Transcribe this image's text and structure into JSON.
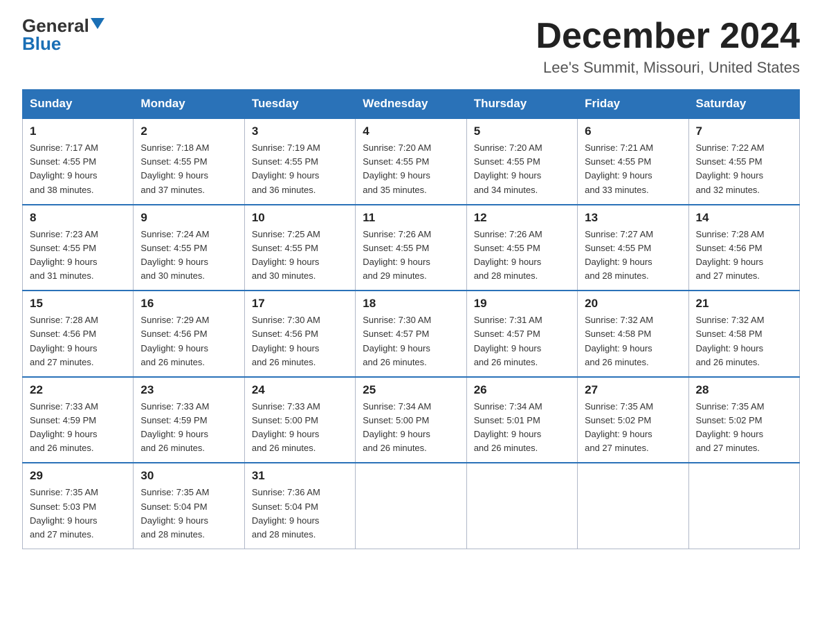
{
  "logo": {
    "general": "General",
    "blue": "Blue"
  },
  "title": "December 2024",
  "location": "Lee's Summit, Missouri, United States",
  "days_of_week": [
    "Sunday",
    "Monday",
    "Tuesday",
    "Wednesday",
    "Thursday",
    "Friday",
    "Saturday"
  ],
  "weeks": [
    [
      {
        "day": "1",
        "sunrise": "7:17 AM",
        "sunset": "4:55 PM",
        "daylight": "9 hours and 38 minutes."
      },
      {
        "day": "2",
        "sunrise": "7:18 AM",
        "sunset": "4:55 PM",
        "daylight": "9 hours and 37 minutes."
      },
      {
        "day": "3",
        "sunrise": "7:19 AM",
        "sunset": "4:55 PM",
        "daylight": "9 hours and 36 minutes."
      },
      {
        "day": "4",
        "sunrise": "7:20 AM",
        "sunset": "4:55 PM",
        "daylight": "9 hours and 35 minutes."
      },
      {
        "day": "5",
        "sunrise": "7:20 AM",
        "sunset": "4:55 PM",
        "daylight": "9 hours and 34 minutes."
      },
      {
        "day": "6",
        "sunrise": "7:21 AM",
        "sunset": "4:55 PM",
        "daylight": "9 hours and 33 minutes."
      },
      {
        "day": "7",
        "sunrise": "7:22 AM",
        "sunset": "4:55 PM",
        "daylight": "9 hours and 32 minutes."
      }
    ],
    [
      {
        "day": "8",
        "sunrise": "7:23 AM",
        "sunset": "4:55 PM",
        "daylight": "9 hours and 31 minutes."
      },
      {
        "day": "9",
        "sunrise": "7:24 AM",
        "sunset": "4:55 PM",
        "daylight": "9 hours and 30 minutes."
      },
      {
        "day": "10",
        "sunrise": "7:25 AM",
        "sunset": "4:55 PM",
        "daylight": "9 hours and 30 minutes."
      },
      {
        "day": "11",
        "sunrise": "7:26 AM",
        "sunset": "4:55 PM",
        "daylight": "9 hours and 29 minutes."
      },
      {
        "day": "12",
        "sunrise": "7:26 AM",
        "sunset": "4:55 PM",
        "daylight": "9 hours and 28 minutes."
      },
      {
        "day": "13",
        "sunrise": "7:27 AM",
        "sunset": "4:55 PM",
        "daylight": "9 hours and 28 minutes."
      },
      {
        "day": "14",
        "sunrise": "7:28 AM",
        "sunset": "4:56 PM",
        "daylight": "9 hours and 27 minutes."
      }
    ],
    [
      {
        "day": "15",
        "sunrise": "7:28 AM",
        "sunset": "4:56 PM",
        "daylight": "9 hours and 27 minutes."
      },
      {
        "day": "16",
        "sunrise": "7:29 AM",
        "sunset": "4:56 PM",
        "daylight": "9 hours and 26 minutes."
      },
      {
        "day": "17",
        "sunrise": "7:30 AM",
        "sunset": "4:56 PM",
        "daylight": "9 hours and 26 minutes."
      },
      {
        "day": "18",
        "sunrise": "7:30 AM",
        "sunset": "4:57 PM",
        "daylight": "9 hours and 26 minutes."
      },
      {
        "day": "19",
        "sunrise": "7:31 AM",
        "sunset": "4:57 PM",
        "daylight": "9 hours and 26 minutes."
      },
      {
        "day": "20",
        "sunrise": "7:32 AM",
        "sunset": "4:58 PM",
        "daylight": "9 hours and 26 minutes."
      },
      {
        "day": "21",
        "sunrise": "7:32 AM",
        "sunset": "4:58 PM",
        "daylight": "9 hours and 26 minutes."
      }
    ],
    [
      {
        "day": "22",
        "sunrise": "7:33 AM",
        "sunset": "4:59 PM",
        "daylight": "9 hours and 26 minutes."
      },
      {
        "day": "23",
        "sunrise": "7:33 AM",
        "sunset": "4:59 PM",
        "daylight": "9 hours and 26 minutes."
      },
      {
        "day": "24",
        "sunrise": "7:33 AM",
        "sunset": "5:00 PM",
        "daylight": "9 hours and 26 minutes."
      },
      {
        "day": "25",
        "sunrise": "7:34 AM",
        "sunset": "5:00 PM",
        "daylight": "9 hours and 26 minutes."
      },
      {
        "day": "26",
        "sunrise": "7:34 AM",
        "sunset": "5:01 PM",
        "daylight": "9 hours and 26 minutes."
      },
      {
        "day": "27",
        "sunrise": "7:35 AM",
        "sunset": "5:02 PM",
        "daylight": "9 hours and 27 minutes."
      },
      {
        "day": "28",
        "sunrise": "7:35 AM",
        "sunset": "5:02 PM",
        "daylight": "9 hours and 27 minutes."
      }
    ],
    [
      {
        "day": "29",
        "sunrise": "7:35 AM",
        "sunset": "5:03 PM",
        "daylight": "9 hours and 27 minutes."
      },
      {
        "day": "30",
        "sunrise": "7:35 AM",
        "sunset": "5:04 PM",
        "daylight": "9 hours and 28 minutes."
      },
      {
        "day": "31",
        "sunrise": "7:36 AM",
        "sunset": "5:04 PM",
        "daylight": "9 hours and 28 minutes."
      },
      {
        "day": "",
        "sunrise": "",
        "sunset": "",
        "daylight": ""
      },
      {
        "day": "",
        "sunrise": "",
        "sunset": "",
        "daylight": ""
      },
      {
        "day": "",
        "sunrise": "",
        "sunset": "",
        "daylight": ""
      },
      {
        "day": "",
        "sunrise": "",
        "sunset": "",
        "daylight": ""
      }
    ]
  ],
  "labels": {
    "sunrise": "Sunrise: ",
    "sunset": "Sunset: ",
    "daylight": "Daylight: "
  }
}
